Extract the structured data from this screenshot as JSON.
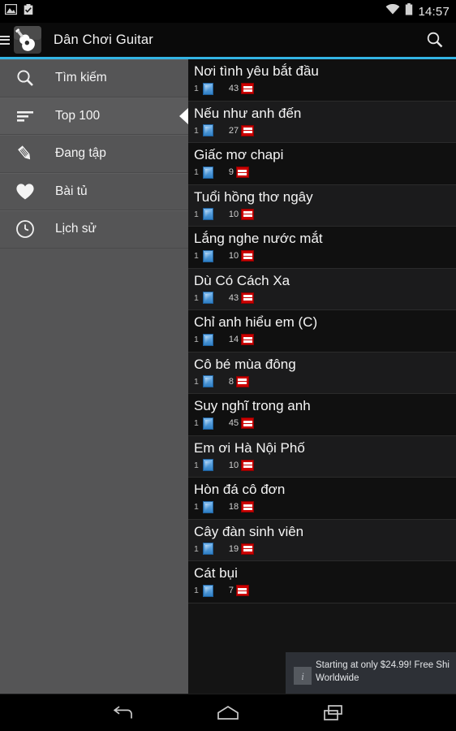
{
  "status_bar": {
    "icons": [
      "image-icon",
      "checkbox-checked-icon"
    ],
    "wifi_icon": "wifi-icon",
    "battery_icon": "battery-icon",
    "clock": "14:57"
  },
  "action_bar": {
    "drawer_icon": "hamburger-menu-icon",
    "logo_icon": "guitar-logo-icon",
    "title": "Dân Chơi Guitar",
    "search_icon": "search-icon"
  },
  "accent_color": "#33b5e5",
  "sidebar": {
    "items": [
      {
        "label": "Tìm kiếm",
        "icon": "search-icon",
        "selected": false
      },
      {
        "label": "Top 100",
        "icon": "list-sort-icon",
        "selected": true
      },
      {
        "label": "Đang tập",
        "icon": "pencil-icon",
        "selected": false
      },
      {
        "label": "Bài tủ",
        "icon": "heart-icon",
        "selected": false
      },
      {
        "label": "Lịch sử",
        "icon": "clock-icon",
        "selected": false
      }
    ]
  },
  "song_list": {
    "chord_badge_icon": "chord-sheet-icon",
    "video_badge_icon": "youtube-icon",
    "rows": [
      {
        "title": "Nơi tình yêu bắt đầu",
        "chords": "1",
        "videos": "43"
      },
      {
        "title": "Nếu như anh đến",
        "chords": "1",
        "videos": "27"
      },
      {
        "title": "Giấc mơ chapi",
        "chords": "1",
        "videos": "9"
      },
      {
        "title": "Tuổi hồng thơ ngây",
        "chords": "1",
        "videos": "10"
      },
      {
        "title": "Lắng nghe nước mắt",
        "chords": "1",
        "videos": "10"
      },
      {
        "title": "Dù Có Cách Xa",
        "chords": "1",
        "videos": "43"
      },
      {
        "title": "Chỉ anh hiểu em (C)",
        "chords": "1",
        "videos": "14"
      },
      {
        "title": "Cô bé mùa đông",
        "chords": "1",
        "videos": "8"
      },
      {
        "title": "Suy nghĩ trong anh",
        "chords": "1",
        "videos": "45"
      },
      {
        "title": "Em ơi Hà Nội Phố",
        "chords": "1",
        "videos": "10"
      },
      {
        "title": "Hòn đá cô đơn",
        "chords": "1",
        "videos": "18"
      },
      {
        "title": "Cây đàn sinh viên",
        "chords": "1",
        "videos": "19"
      },
      {
        "title": "Cát bụi",
        "chords": "1",
        "videos": "7"
      }
    ]
  },
  "ad_banner": {
    "info_icon": "info-icon",
    "info_glyph": "i",
    "line1": "Starting at only $24.99! Free Shi",
    "line2": "Worldwide"
  },
  "nav_bar": {
    "back_icon": "back-arrow-icon",
    "home_icon": "home-icon",
    "recents_icon": "recent-apps-icon"
  }
}
